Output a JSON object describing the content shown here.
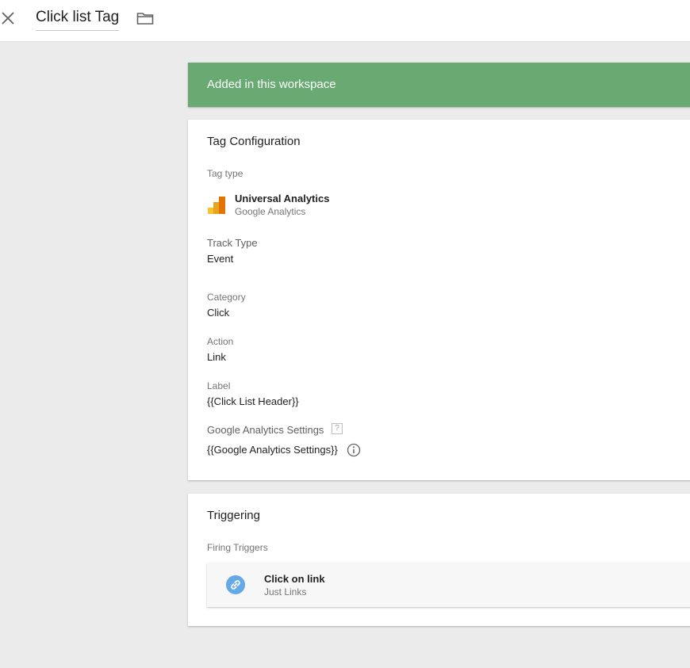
{
  "header": {
    "title": "Click list Tag",
    "close_icon": "close-icon",
    "folder_icon": "folder-icon"
  },
  "banner": {
    "text": "Added in this workspace",
    "color": "#69a972"
  },
  "tag_configuration": {
    "title": "Tag Configuration",
    "tag_type_label": "Tag type",
    "tag_type_name": "Universal Analytics",
    "tag_type_provider": "Google Analytics",
    "tag_type_icon": "google-analytics-icon",
    "track_type_label": "Track Type",
    "track_type_value": "Event",
    "category_label": "Category",
    "category_value": "Click",
    "action_label": "Action",
    "action_value": "Link",
    "label_label": "Label",
    "label_value": "{{Click List Header}}",
    "ga_settings_label": "Google Analytics Settings",
    "ga_settings_help": "?",
    "ga_settings_value": "{{Google Analytics Settings}}",
    "info_icon": "info-icon"
  },
  "triggering": {
    "title": "Triggering",
    "firing_label": "Firing Triggers",
    "trigger_name": "Click on link",
    "trigger_type": "Just Links",
    "trigger_icon": "link-icon",
    "trigger_icon_color": "#64a8e8"
  }
}
